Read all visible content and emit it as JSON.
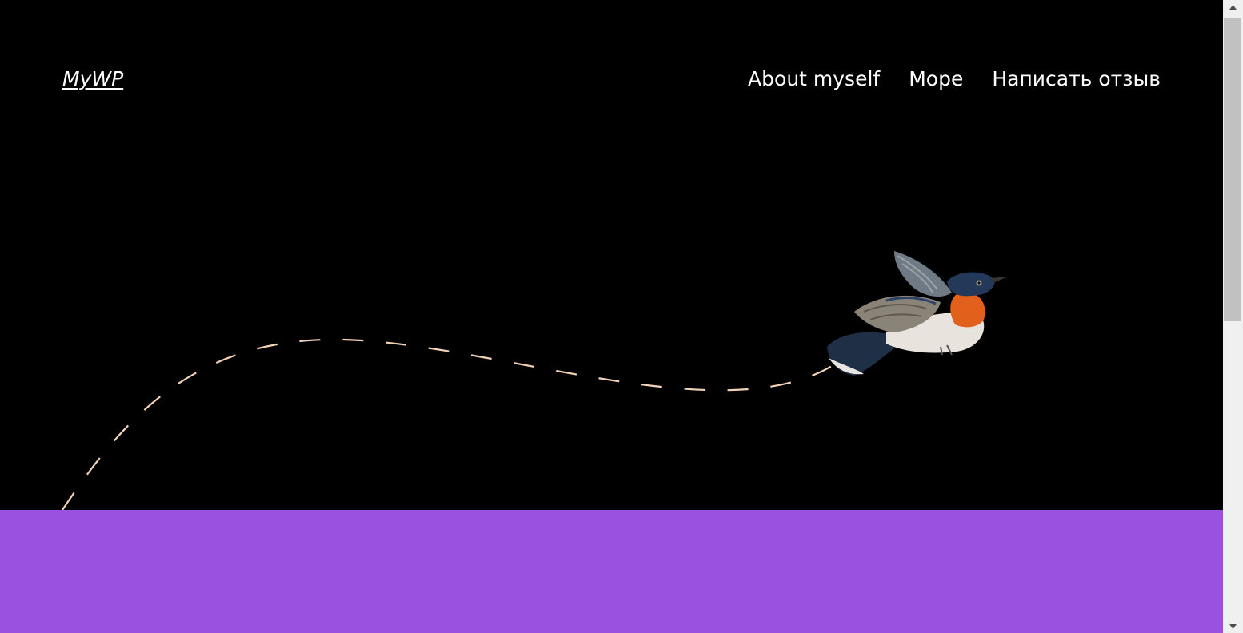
{
  "site": {
    "title": "MyWP"
  },
  "nav": {
    "items": [
      "About myself",
      "Море",
      "Написать отзыв"
    ]
  },
  "band": {
    "heading": "",
    "color": "#9b51e0"
  },
  "hero": {
    "background": "#000000",
    "path_color": "#f2d3b8"
  },
  "icons": {
    "hero_image": "bird-icon",
    "scroll_up": "arrow-up-icon",
    "scroll_down": "arrow-down-icon"
  }
}
